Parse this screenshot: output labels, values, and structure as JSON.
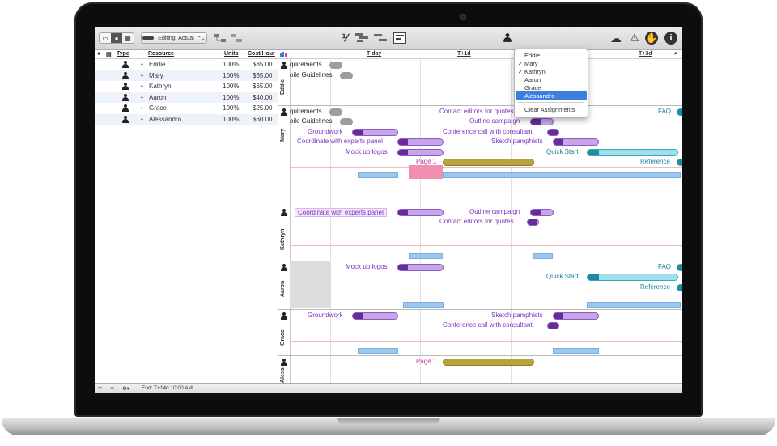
{
  "toolbar": {
    "editing_label": "Editing: Actual",
    "editing_arrows": "⌃⌄",
    "icons": [
      "split-view-icon",
      "person-view-icon",
      "table-view-icon",
      "network-icon",
      "connect-icon",
      "fraction-icon",
      "gantt-bars-icon",
      "reorder-icon",
      "inspector-view-icon",
      "assign-resource-icon",
      "cloud-publish-icon",
      "warning-icon",
      "style-icon",
      "info-icon"
    ],
    "fraction_symbol": "⅟",
    "warning_symbol": "⚠",
    "info_symbol": "i",
    "style_symbol": "✋",
    "cloud_symbol": "☁"
  },
  "resources": {
    "headers": {
      "type": "Type",
      "resource": "Resource",
      "units": "Units",
      "cost": "Cost/Hour"
    },
    "rows": [
      {
        "name": "Eddie",
        "units": "100%",
        "cost": "$35.00"
      },
      {
        "name": "Mary",
        "units": "100%",
        "cost": "$65.00"
      },
      {
        "name": "Kathryn",
        "units": "100%",
        "cost": "$65.00"
      },
      {
        "name": "Aaron",
        "units": "100%",
        "cost": "$40.00"
      },
      {
        "name": "Grace",
        "units": "100%",
        "cost": "$25.00"
      },
      {
        "name": "Alessandro",
        "units": "100%",
        "cost": "$60.00"
      }
    ]
  },
  "bottom": {
    "add": "+",
    "remove": "−",
    "gear": "⚙▾",
    "end": "End: T+14d 10:00 AM"
  },
  "timeline": {
    "col1": "T day",
    "col2": "T+1d",
    "col3": "T+3d"
  },
  "lanes": {
    "eddie": "Eddie",
    "mary": "Mary",
    "kathryn": "Kathryn",
    "aaron": "Aaron",
    "grace": "Grace",
    "alessandro": "Alessandro"
  },
  "tasks": {
    "requirements": "quirements",
    "guidelines": "oile Guidelines",
    "requirements2": "quirements",
    "guidelines2": "oile Guidelines",
    "groundwork": "Groundwork",
    "coordinate": "Coordinate with experts panel",
    "mockup": "Mock up logos",
    "page1": "Page 1",
    "contact": "Contact editors for quotes",
    "outline": "Outline campaign",
    "conference": "Conference call with consultant",
    "sketch": "Sketch pamphlets",
    "quickstart": "Quick Start",
    "faq": "FAQ",
    "reference": "Reference",
    "k_coordinate": "Coordinate with experts panel",
    "k_outline": "Outline campaign",
    "k_contact": "Contact editors for quotes",
    "a_mockup": "Mock up logos",
    "a_faq": "FAQ",
    "a_quickstart": "Quick Start",
    "a_reference": "Reference",
    "g_groundwork": "Groundwork",
    "g_sketch": "Sketch pamphlets",
    "g_conference": "Conference call with consultant",
    "al_page1": "Page 1"
  },
  "dropdown": {
    "items": [
      {
        "check": "",
        "label": "Eddie"
      },
      {
        "check": "✓",
        "label": "Mary"
      },
      {
        "check": "✓",
        "label": "Kathryn"
      },
      {
        "check": "",
        "label": "Aaron"
      },
      {
        "check": "",
        "label": "Grace"
      },
      {
        "check": "",
        "label": "Alessandro"
      }
    ],
    "clear": "Clear Assignments"
  }
}
